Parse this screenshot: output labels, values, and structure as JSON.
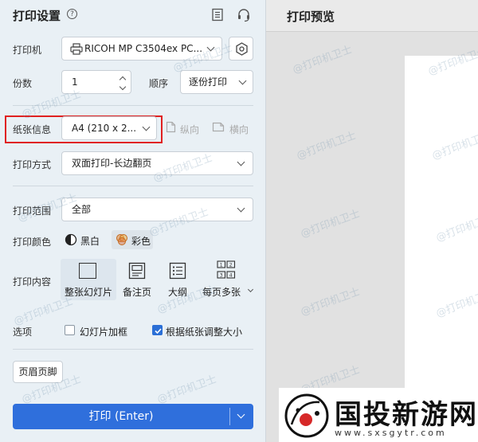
{
  "panel": {
    "title": "打印设置",
    "printer_label": "打印机",
    "printer_value": "RICOH MP C3504ex PC...",
    "copies_label": "份数",
    "copies_value": "1",
    "order_label": "顺序",
    "order_value": "逐份打印",
    "paper_label": "纸张信息",
    "paper_value": "A4 (210 x 2...",
    "portrait_label": "纵向",
    "landscape_label": "横向",
    "print_mode_label": "打印方式",
    "print_mode_value": "双面打印-长边翻页",
    "range_label": "打印范围",
    "range_value": "全部",
    "color_label": "打印颜色",
    "color_bw": "黑白",
    "color_color": "彩色",
    "content_label": "打印内容",
    "content_items": [
      "整张幻灯片",
      "备注页",
      "大纲",
      "每页多张"
    ],
    "options_label": "选项",
    "option_frame": "幻灯片加框",
    "option_frame_checked": false,
    "option_fit": "根据纸张调整大小",
    "option_fit_checked": true,
    "header_footer_button": "页眉页脚",
    "print_button": "打印 (Enter)"
  },
  "preview": {
    "title": "打印预览"
  },
  "watermark": "@打印机卫士",
  "promo": {
    "name": "国投新游网",
    "url": "www.sxsgytr.com"
  },
  "colors": {
    "accent": "#2f6fdc",
    "highlight": "#e02020"
  }
}
